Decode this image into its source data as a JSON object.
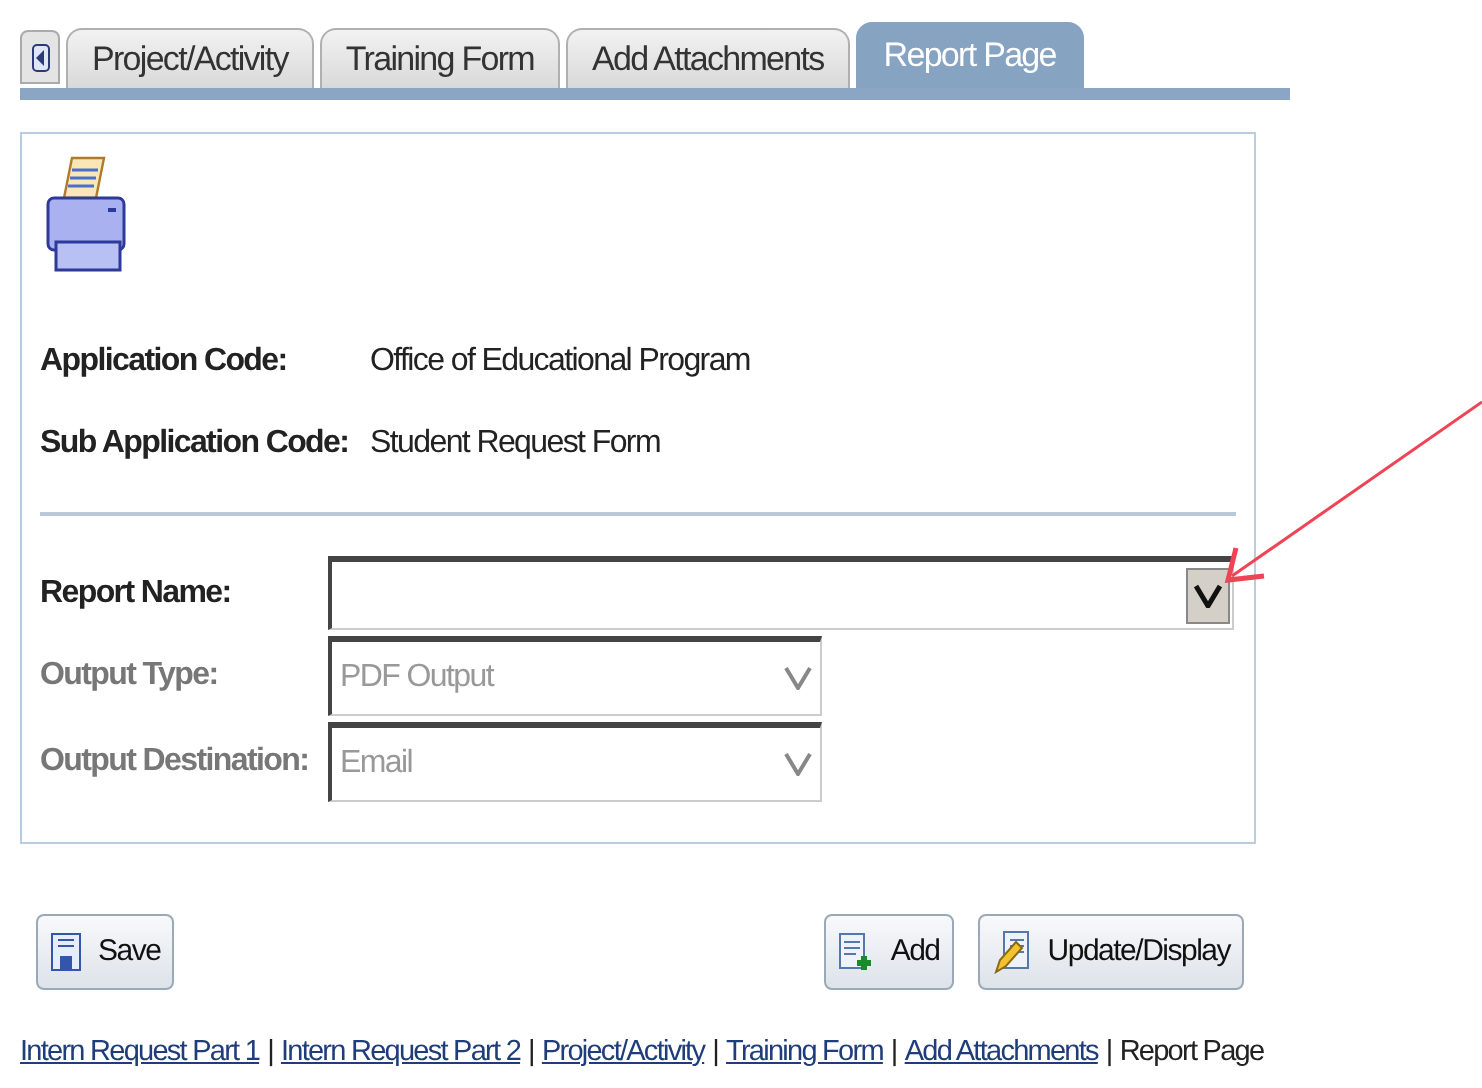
{
  "tabs": [
    {
      "label": "Project/Activity",
      "selected": false
    },
    {
      "label": "Training Form",
      "selected": false
    },
    {
      "label": "Add Attachments",
      "selected": false
    },
    {
      "label": "Report Page",
      "selected": true
    }
  ],
  "info": [
    {
      "label": "Application Code:",
      "value": "Office of Educational Program"
    },
    {
      "label": "Sub Application Code:",
      "value": "Student Request Form"
    }
  ],
  "fields": [
    {
      "label": "Report Name:",
      "disabled": false,
      "wide": true
    },
    {
      "label": "Output Type:",
      "value": "PDF Output",
      "disabled": true,
      "wide": false
    },
    {
      "label": "Output Destination:",
      "value": "Email",
      "disabled": true,
      "wide": false
    }
  ],
  "buttons": [
    {
      "label": "Save",
      "kind": "save"
    },
    {
      "label": "Add",
      "kind": "add"
    },
    {
      "label": "Update/Display",
      "kind": "update"
    }
  ],
  "nav_links": [
    {
      "label": "Intern Request Part 1",
      "current": false
    },
    {
      "label": "Intern Request Part 2",
      "current": false
    },
    {
      "label": "Project/Activity",
      "current": false
    },
    {
      "label": "Training Form",
      "current": false
    },
    {
      "label": "Add Attachments",
      "current": false
    },
    {
      "label": "Report Page",
      "current": true
    }
  ],
  "separator": "|"
}
